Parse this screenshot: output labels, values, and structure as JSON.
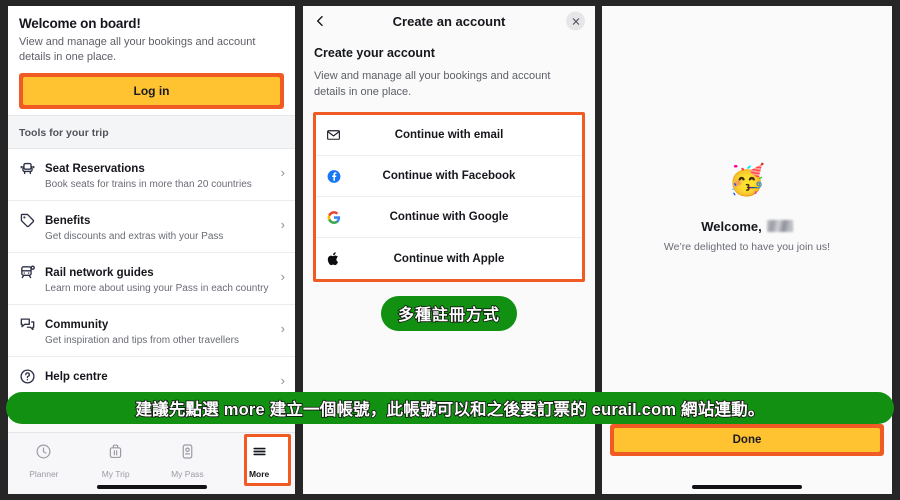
{
  "left_panel": {
    "hero": {
      "title": "Welcome on board!",
      "subtitle": "View and manage all your bookings and account details in one place.",
      "login_label": "Log in"
    },
    "section_header": "Tools for your trip",
    "menu_items": [
      {
        "icon": "seat-icon",
        "title": "Seat Reservations",
        "desc": "Book seats for trains in more than 20 countries",
        "chevron": "›"
      },
      {
        "icon": "tag-icon",
        "title": "Benefits",
        "desc": "Get discounts and extras with your Pass",
        "chevron": "›"
      },
      {
        "icon": "train-icon",
        "title": "Rail network guides",
        "desc": "Learn more about using your Pass in each country",
        "chevron": "›"
      },
      {
        "icon": "chat-icon",
        "title": "Community",
        "desc": "Get inspiration and tips from other travellers",
        "chevron": "›"
      },
      {
        "icon": "question-circle-icon",
        "title": "Help centre",
        "desc": "",
        "chevron": "›"
      }
    ],
    "tabbar": [
      {
        "icon": "clock-icon",
        "label": "Planner",
        "active": false
      },
      {
        "icon": "suitcase-icon",
        "label": "My Trip",
        "active": false
      },
      {
        "icon": "pass-icon",
        "label": "My Pass",
        "active": false
      },
      {
        "icon": "hamburger-icon",
        "label": "More",
        "active": true
      }
    ]
  },
  "middle_panel": {
    "nav_title": "Create an account",
    "back_icon": "chevron-left-icon",
    "close_icon": "close-icon",
    "heading": "Create your account",
    "paragraph": "View and manage all your bookings and account details in one place.",
    "providers": [
      {
        "icon": "email-icon",
        "label": "Continue with email"
      },
      {
        "icon": "facebook-icon",
        "label": "Continue with Facebook"
      },
      {
        "icon": "google-icon",
        "label": "Continue with Google"
      },
      {
        "icon": "apple-icon",
        "label": "Continue with Apple"
      }
    ],
    "annotation_pill": "多種註冊方式"
  },
  "right_panel": {
    "emoji": "🥳",
    "welcome_prefix": "Welcome,",
    "welcome_name_redacted": true,
    "delight_text": "We’re delighted to have you join us!",
    "done_label": "Done"
  },
  "overlay": {
    "banner_text": "建議先點選 more 建立一個帳號，此帳號可以和之後要訂票的 eurail.com 網站連動。"
  },
  "colors": {
    "highlight_orange": "#EF5B22",
    "button_yellow": "#FFC231",
    "annotation_green": "#119011",
    "page_bg": "#262626"
  }
}
